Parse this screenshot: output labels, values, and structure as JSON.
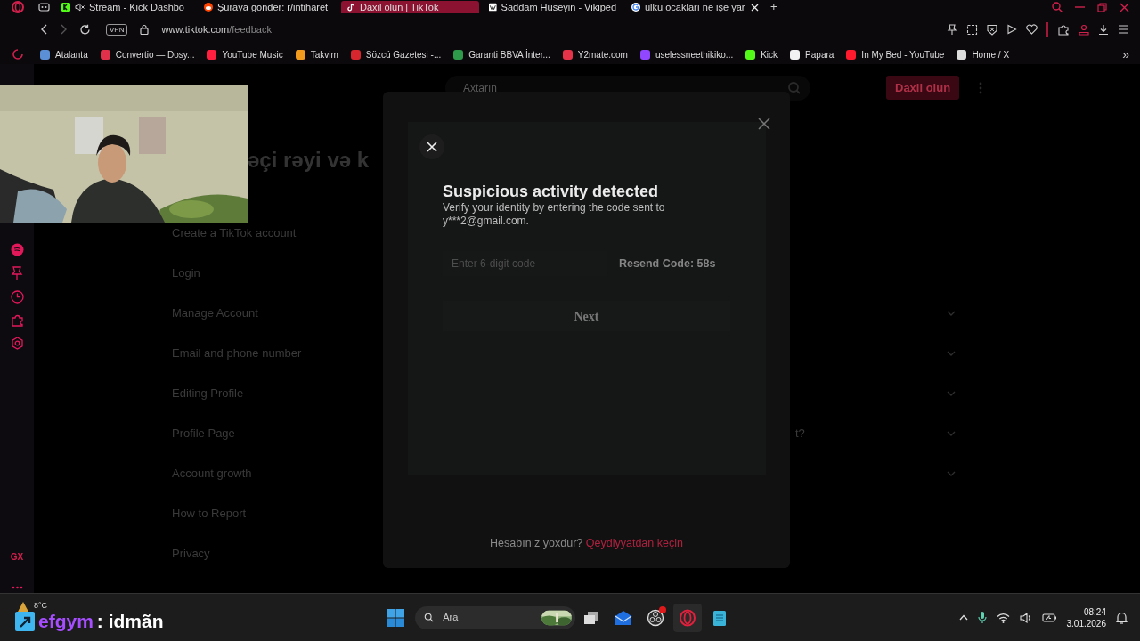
{
  "browser": {
    "tabs": [
      {
        "title": "Stream - Kick Dashbo",
        "muted": true,
        "closable": false,
        "selected": false
      },
      {
        "title": "Şuraya gönder: r/intiharet",
        "muted": false,
        "closable": false,
        "selected": false
      },
      {
        "title": "Daxil olun | TikTok",
        "muted": false,
        "closable": false,
        "selected": true
      },
      {
        "title": "Saddam Hüseyin - Vikiped",
        "muted": false,
        "closable": false,
        "selected": false
      },
      {
        "title": "ülkü ocakları ne işe yar",
        "muted": false,
        "closable": true,
        "selected": false
      }
    ],
    "new_tab": "+",
    "address": {
      "vpn": "VPN",
      "host": "www.tiktok.com",
      "path": "/feedback"
    },
    "bookmarks": [
      {
        "label": "Atalanta",
        "color": "#5b8fd6"
      },
      {
        "label": "Convertio — Dosy...",
        "color": "#e0304a"
      },
      {
        "label": "YouTube Music",
        "color": "#ff2040"
      },
      {
        "label": "Takvim",
        "color": "#f29b1d"
      },
      {
        "label": "Sözcü Gazetesi -...",
        "color": "#d7262e"
      },
      {
        "label": "Garanti BBVA İnter...",
        "color": "#2e9b4a"
      },
      {
        "label": "Y2mate.com",
        "color": "#e5344a"
      },
      {
        "label": "uselessneethikiko...",
        "color": "#9146ff"
      },
      {
        "label": "Kick",
        "color": "#53fc18"
      },
      {
        "label": "Papara",
        "color": "#f2f2f2"
      },
      {
        "label": "In My Bed - YouTube",
        "color": "#ff1a2e"
      },
      {
        "label": "Home / X",
        "color": "#dddddd"
      }
    ],
    "bookmarks_more": "»"
  },
  "sidebar": {
    "brand": "GX"
  },
  "page": {
    "search_placeholder": "Axtarın",
    "login_button": "Daxil olun",
    "heading": "əçi rəyi və k",
    "topics": [
      {
        "label": "Create a TikTok account",
        "expandable": false
      },
      {
        "label": "Login",
        "expandable": false
      },
      {
        "label": "Manage Account",
        "expandable": true
      },
      {
        "label": "Email and phone number",
        "expandable": true
      },
      {
        "label": "Editing Profile",
        "expandable": true
      },
      {
        "label": "Profile Page",
        "expandable": true,
        "question": "t?"
      },
      {
        "label": "Account growth",
        "expandable": true
      },
      {
        "label": "How to Report",
        "expandable": false
      },
      {
        "label": "Privacy",
        "expandable": false
      }
    ]
  },
  "modal": {
    "title": "Suspicious activity detected",
    "description": "Verify your identity by entering the code sent to y***2@gmail.com.",
    "code_placeholder": "Enter 6-digit code",
    "resend": "Resend Code: 58s",
    "next_button": "Next",
    "footer_text": "Hesabınız yoxdur?",
    "footer_link": "Qeydiyyatdan keçin"
  },
  "taskbar": {
    "temperature": "8°C",
    "search_placeholder": "Ara",
    "time": "08:24",
    "date": "3.01.2026"
  },
  "chat_overlay": {
    "user": "efgym",
    "message": ": idmãn"
  }
}
